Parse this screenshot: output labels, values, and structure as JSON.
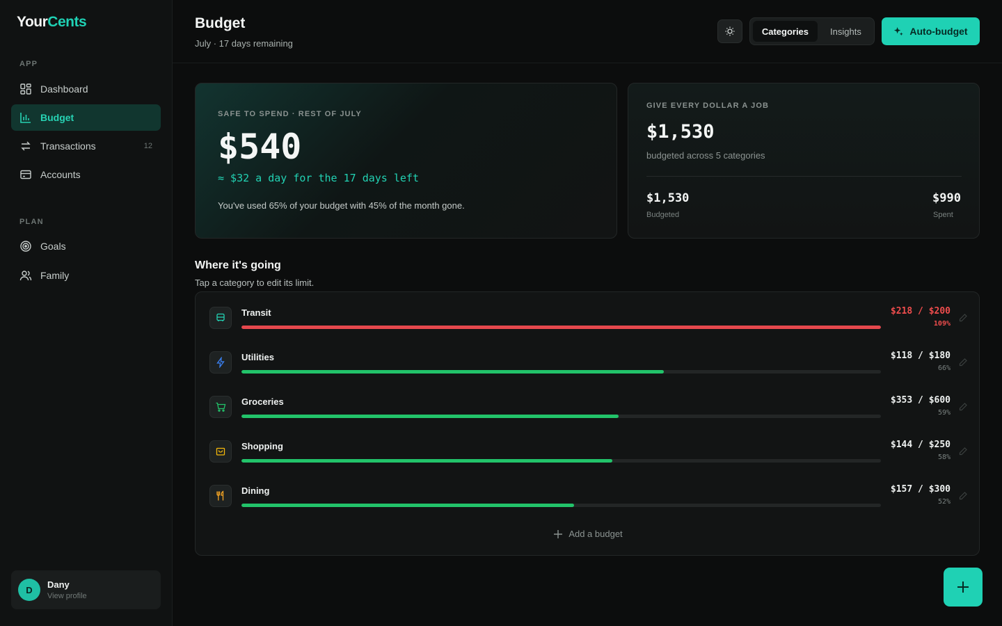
{
  "app": {
    "logo_a": "Your",
    "logo_b": "Cents"
  },
  "sidebar": {
    "sections": [
      {
        "title": "APP",
        "items": [
          {
            "label": "Dashboard",
            "icon": "grid-icon"
          },
          {
            "label": "Budget",
            "icon": "bar-chart-icon",
            "active": true
          },
          {
            "label": "Transactions",
            "icon": "swap-arrows-icon",
            "count": "12"
          },
          {
            "label": "Accounts",
            "icon": "card-icon"
          }
        ]
      },
      {
        "title": "PLAN",
        "items": [
          {
            "label": "Goals",
            "icon": "target-icon"
          },
          {
            "label": "Family",
            "icon": "users-icon"
          }
        ]
      }
    ],
    "profile": {
      "initial": "D",
      "name": "Dany",
      "sub": "View profile"
    }
  },
  "header": {
    "title": "Budget",
    "subtitle": "July · 17 days remaining",
    "tabs": [
      {
        "label": "Categories",
        "active": true
      },
      {
        "label": "Insights"
      }
    ],
    "auto_budget_label": "Auto-budget"
  },
  "safe_card": {
    "eyebrow": "SAFE TO SPEND · REST OF JULY",
    "amount": "$540",
    "per_day": "≈ $32 a day for the 17 days left",
    "used_note": "You've used 65% of your budget with 45% of the month gone."
  },
  "job_card": {
    "eyebrow": "GIVE EVERY DOLLAR A JOB",
    "amount": "$1,530",
    "sub": "budgeted across 5 categories",
    "budgeted_value": "$1,530",
    "budgeted_label": "Budgeted",
    "spent_value": "$990",
    "spent_label": "Spent"
  },
  "categories_section": {
    "title": "Where it's going",
    "subtitle": "Tap a category to edit its limit.",
    "add_label": "Add a budget",
    "items": [
      {
        "name": "Transit",
        "icon": "bus-icon",
        "icon_color": "#22d2b3",
        "spent": "$218",
        "limit": "$200",
        "amount_text": "$218 / $200",
        "pct_text": "109%",
        "progress": 1.0,
        "over": true
      },
      {
        "name": "Utilities",
        "icon": "bolt-icon",
        "icon_color": "#3b82f6",
        "spent": "$118",
        "limit": "$180",
        "amount_text": "$118 / $180",
        "pct_text": "66%",
        "progress": 0.66,
        "over": false
      },
      {
        "name": "Groceries",
        "icon": "cart-icon",
        "icon_color": "#22c36a",
        "spent": "$353",
        "limit": "$600",
        "amount_text": "$353 / $600",
        "pct_text": "59%",
        "progress": 0.59,
        "over": false
      },
      {
        "name": "Shopping",
        "icon": "bag-icon",
        "icon_color": "#f5b90b",
        "spent": "$144",
        "limit": "$250",
        "amount_text": "$144 / $250",
        "pct_text": "58%",
        "progress": 0.58,
        "over": false
      },
      {
        "name": "Dining",
        "icon": "utensils-icon",
        "icon_color": "#f5a524",
        "spent": "$157",
        "limit": "$300",
        "amount_text": "$157 / $300",
        "pct_text": "52%",
        "progress": 0.52,
        "over": false
      }
    ]
  },
  "colors": {
    "accent": "#1fd1b4",
    "good": "#22c36a",
    "over": "#e5484d"
  }
}
